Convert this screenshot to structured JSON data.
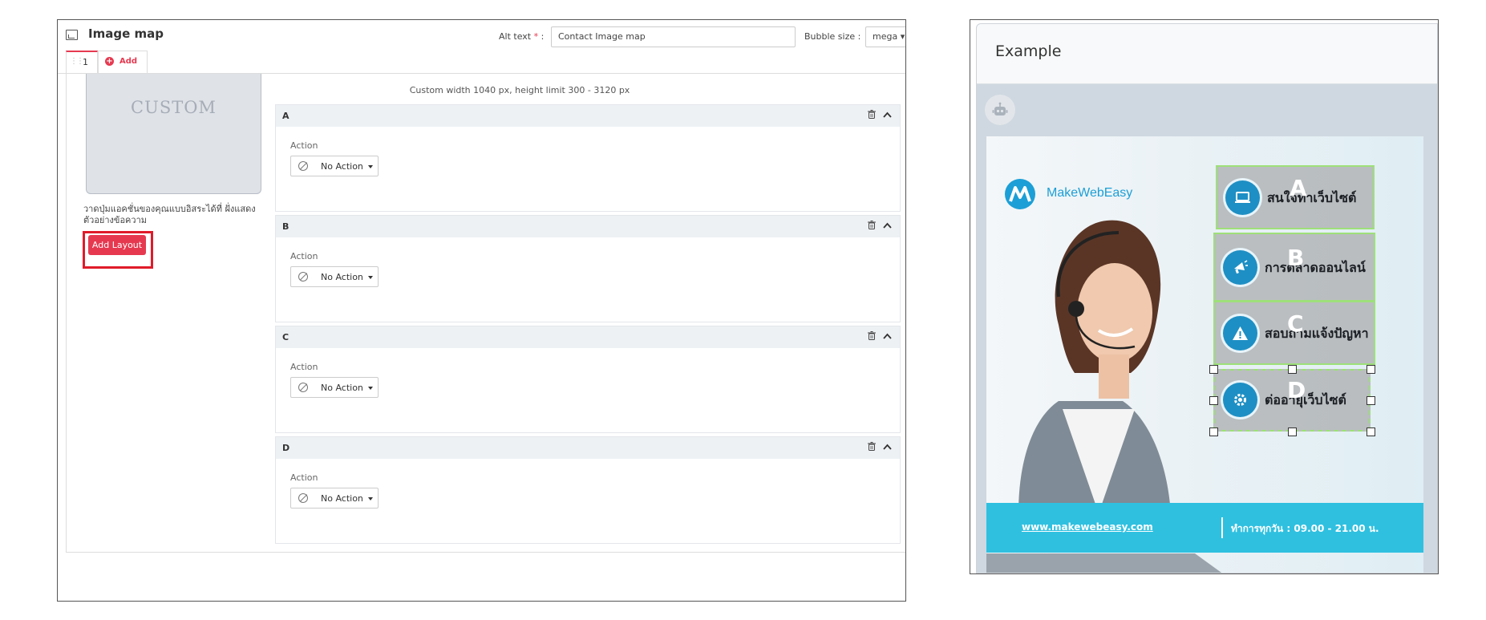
{
  "editor": {
    "title": "Image map",
    "alt_text_label": "Alt text",
    "alt_text_required_mark": "*",
    "alt_text_colon": ":",
    "alt_text_value": "Contact Image map",
    "bubble_size_label": "Bubble size :",
    "bubble_size_value": "mega",
    "tabs": [
      {
        "label": "1"
      }
    ],
    "add_tab_label": "Add",
    "custom_layout": {
      "thumbnail_label": "CUSTOM",
      "description": "วาดปุ่มแอคชั่นของคุณแบบอิสระได้ที่ ฝั่งแสดงตัวอย่างข้อความ",
      "add_layout_button": "Add Layout"
    },
    "size_note": "Custom width 1040 px, height limit 300 - 3120 px",
    "areas": [
      {
        "letter": "A",
        "action_label": "Action",
        "action_value": "No Action"
      },
      {
        "letter": "B",
        "action_label": "Action",
        "action_value": "No Action"
      },
      {
        "letter": "C",
        "action_label": "Action",
        "action_value": "No Action"
      },
      {
        "letter": "D",
        "action_label": "Action",
        "action_value": "No Action"
      }
    ]
  },
  "example": {
    "title": "Example",
    "bot_icon": "robot-icon",
    "banner": {
      "logo_text": "MakeWebEasy",
      "hotspots": [
        {
          "letter": "A",
          "text": "สนใจทำเว็บไซต์",
          "icon": "laptop-icon"
        },
        {
          "letter": "B",
          "text": "การตลาดออนไลน์",
          "icon": "megaphone-icon"
        },
        {
          "letter": "C",
          "text": "สอบถามแจ้งปัญหา",
          "icon": "warning-icon"
        },
        {
          "letter": "D",
          "text": "ต่ออายุเว็บไซต์",
          "icon": "gear-icon"
        }
      ],
      "url": "www.makewebeasy.com",
      "hours": "ทำการทุกวัน : 09.00 - 21.00 น."
    }
  },
  "colors": {
    "accent": "#e63950",
    "highlight_outline": "#e01b2a",
    "hotspot_border": "#9ee07a",
    "banner_blue": "#2fc0e0",
    "icon_blue": "#1e8fc4"
  }
}
